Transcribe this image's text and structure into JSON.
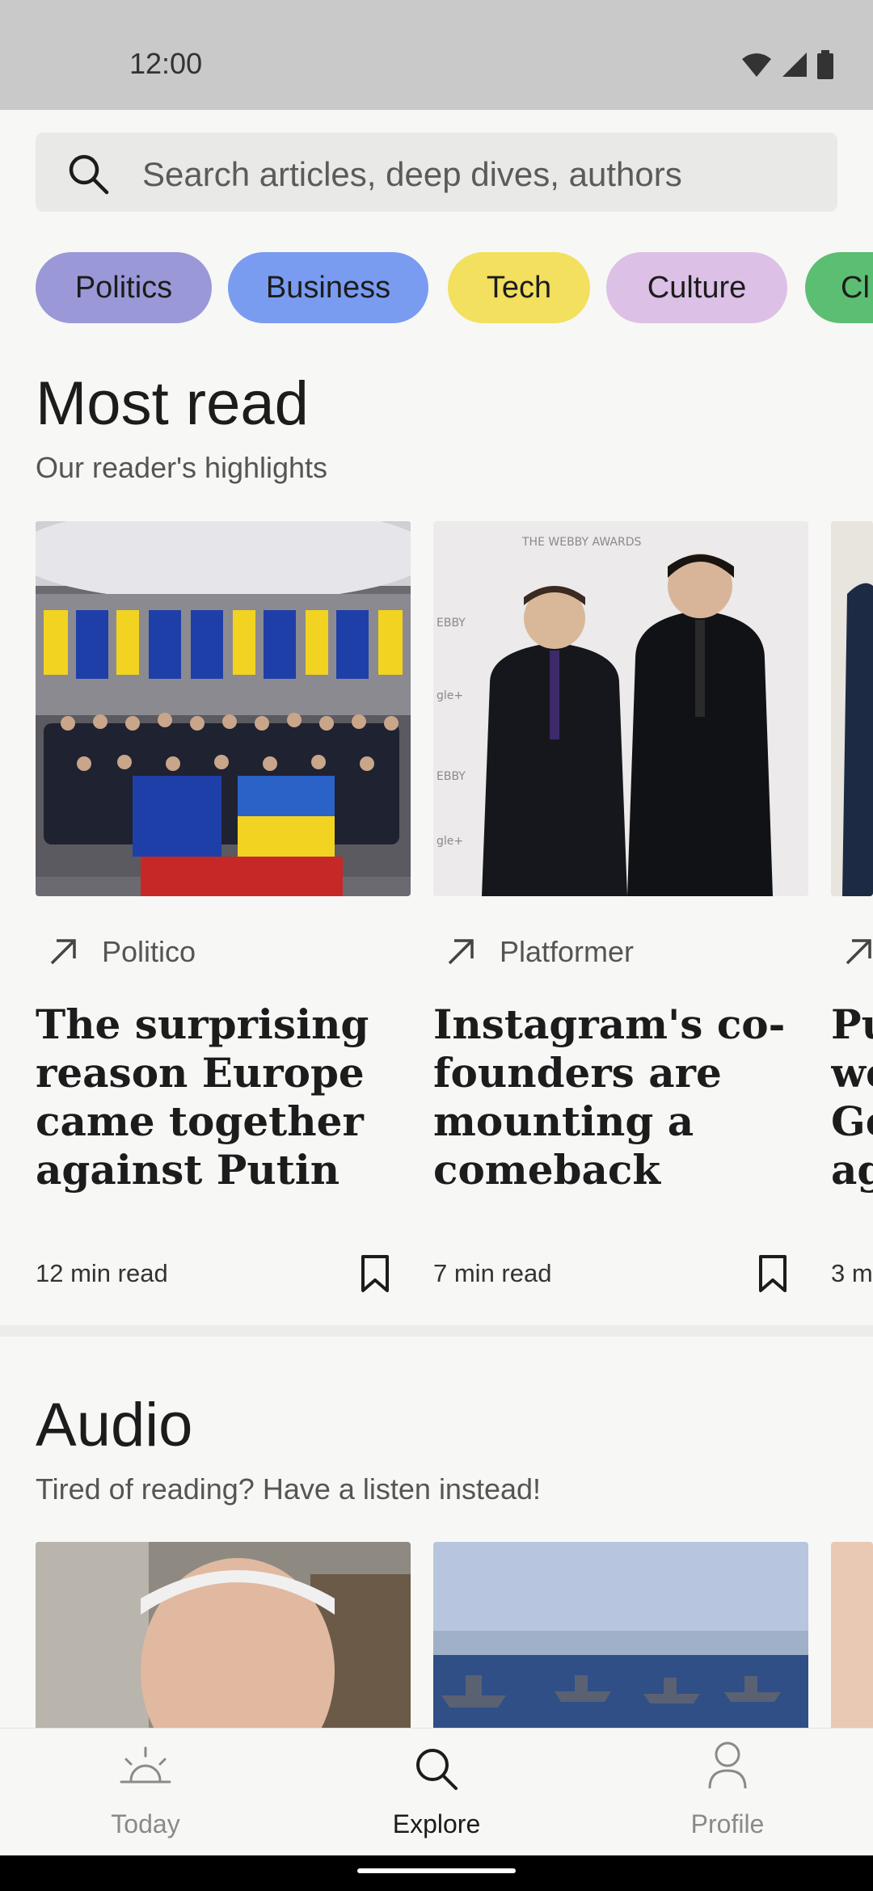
{
  "status_bar": {
    "time": "12:00"
  },
  "search": {
    "placeholder": "Search articles, deep dives, authors"
  },
  "categories": [
    {
      "label": "Politics",
      "color": "#9b98d8"
    },
    {
      "label": "Business",
      "color": "#7a9cf0"
    },
    {
      "label": "Tech",
      "color": "#f2e05e"
    },
    {
      "label": "Culture",
      "color": "#dcc0e6"
    },
    {
      "label": "Cl",
      "color": "#5cbe73"
    }
  ],
  "most_read": {
    "title": "Most read",
    "subtitle": "Our reader's highlights",
    "cards": [
      {
        "source": "Politico",
        "title": "The surprising reason Europe came together against Putin",
        "read_time": "12 min read",
        "image": "eu-ukraine-group-photo"
      },
      {
        "source": "Platformer",
        "title": "Instagram's co-founders are mounting a comeback",
        "read_time": "7 min read",
        "image": "webby-awards-two-men"
      },
      {
        "source": "",
        "title": "Pu we Ge ag",
        "read_time": "3 m",
        "image": "partial-card"
      }
    ]
  },
  "audio": {
    "title": "Audio",
    "subtitle": "Tired of reading? Have a listen instead!",
    "cards": [
      {
        "image": "man-portrait"
      },
      {
        "image": "naval-ships"
      },
      {
        "image": "partial"
      }
    ]
  },
  "bottom_nav": {
    "items": [
      {
        "label": "Today",
        "active": false
      },
      {
        "label": "Explore",
        "active": true
      },
      {
        "label": "Profile",
        "active": false
      }
    ]
  },
  "colors": {
    "background": "#f7f7f5",
    "text": "#1c1c1c",
    "muted": "#555555"
  }
}
